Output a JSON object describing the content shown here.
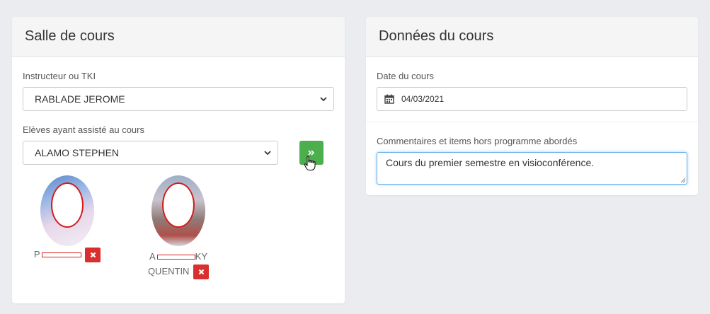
{
  "classroom_card": {
    "title": "Salle de cours",
    "instructor_label": "Instructeur ou TKI",
    "instructor_value": "RABLADE JEROME",
    "students_label": "Elèves ayant assisté au cours",
    "student_select_value": "ALAMO STEPHEN",
    "add_button_icon": "double-chevron-right-icon",
    "students": [
      {
        "name_visible": "P",
        "name_visible_after": "",
        "name_line2": ""
      },
      {
        "name_visible": "A",
        "name_visible_after": "KY",
        "name_line2": "QUENTIN"
      }
    ]
  },
  "course_card": {
    "title": "Données du cours",
    "date_label": "Date du cours",
    "date_value": "04/03/2021",
    "comments_label": "Commentaires et items hors programme abordés",
    "comments_value": "Cours du premier semestre en visioconférence."
  },
  "colors": {
    "background": "#ebecef",
    "add_button": "#4cae4c",
    "remove_button": "#d9302f",
    "focus_border": "#66afe9"
  }
}
